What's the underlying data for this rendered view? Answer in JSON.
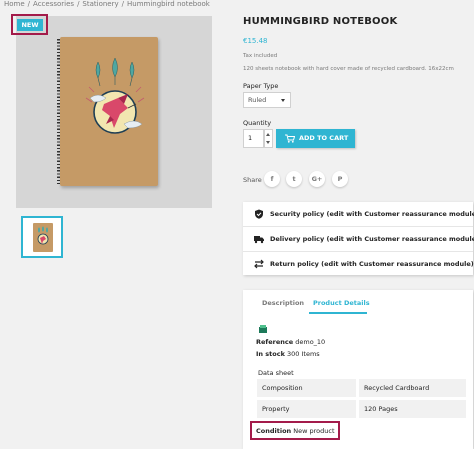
{
  "breadcrumb": [
    "Home",
    "Accessories",
    "Stationery",
    "Hummingbird notebook"
  ],
  "badge": {
    "label": "NEW",
    "color": "#2fb5d2",
    "highlight_color": "#a31b4a"
  },
  "product": {
    "title": "HUMMINGBIRD NOTEBOOK",
    "price": "€15.48",
    "tax": "Tax included",
    "description": "120 sheets notebook with hard cover made of recycled cardboard. 16x22cm"
  },
  "variant": {
    "label": "Paper Type",
    "selected": "Ruled"
  },
  "quantity": {
    "label": "Quantity",
    "value": "1"
  },
  "add_to_cart": {
    "label": "ADD TO CART",
    "icon": "cart-icon"
  },
  "share": {
    "label": "Share",
    "networks": [
      {
        "icon": "facebook-icon",
        "glyph": "f"
      },
      {
        "icon": "twitter-icon",
        "glyph": "t"
      },
      {
        "icon": "google-plus-icon",
        "glyph": "G+"
      },
      {
        "icon": "pinterest-icon",
        "glyph": "P"
      }
    ]
  },
  "reassurance": [
    {
      "icon": "shield-icon",
      "text": "Security policy (edit with Customer reassurance module)"
    },
    {
      "icon": "truck-icon",
      "text": "Delivery policy (edit with Customer reassurance module)"
    },
    {
      "icon": "return-arrows-icon",
      "text": "Return policy (edit with Customer reassurance module)"
    }
  ],
  "tabs": {
    "description": "Description",
    "details": "Product Details",
    "active": "details"
  },
  "details": {
    "reference_label": "Reference",
    "reference_value": "demo_10",
    "stock_label": "In stock",
    "stock_value": "300 Items",
    "datasheet_title": "Data sheet",
    "datasheet": [
      {
        "name": "Composition",
        "value": "Recycled Cardboard"
      },
      {
        "name": "Property",
        "value": "120 Pages"
      }
    ],
    "condition_label": "Condition",
    "condition_value": "New product"
  },
  "colors": {
    "accent": "#2fb5d2",
    "highlight": "#a31b4a",
    "cardboard": "#c59a66"
  }
}
